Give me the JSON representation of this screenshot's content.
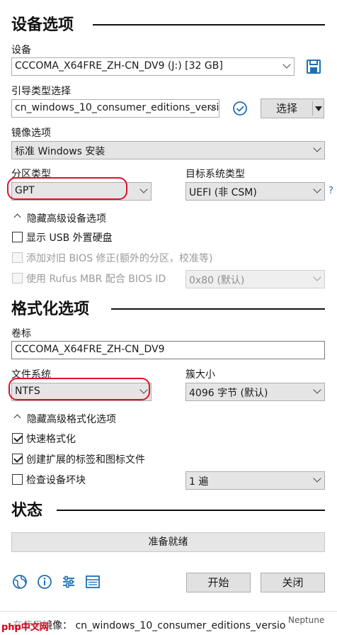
{
  "device_section": {
    "title": "设备选项",
    "device_label": "设备",
    "device_value": "CCCOMA_X64FRE_ZH-CN_DV9 (J:) [32 GB]",
    "boot_label": "引导类型选择",
    "boot_value": "cn_windows_10_consumer_editions_versio",
    "select_button": "选择",
    "image_option_label": "镜像选项",
    "image_option_value": "标准 Windows 安装",
    "partition_label": "分区类型",
    "partition_value": "GPT",
    "target_label": "目标系统类型",
    "target_value": "UEFI (非 CSM)",
    "help_mark": "?",
    "advanced_toggle": "隐藏高级设备选项",
    "usb_hdd_label": "显示 USB 外置硬盘",
    "old_bios_label": "添加对旧 BIOS 修正(额外的分区，校准等)",
    "rufus_mbr_label": "使用 Rufus MBR 配合 BIOS ID",
    "bios_id_value": "0x80 (默认)"
  },
  "format_section": {
    "title": "格式化选项",
    "volume_label": "卷标",
    "volume_value": "CCCOMA_X64FRE_ZH-CN_DV9",
    "fs_label": "文件系统",
    "fs_value": "NTFS",
    "cluster_label": "簇大小",
    "cluster_value": "4096 字节 (默认)",
    "advanced_toggle": "隐藏高级格式化选项",
    "quick_format_label": "快速格式化",
    "extended_label": "创建扩展的标签和图标文件",
    "bad_blocks_label": "检查设备坏块",
    "passes_value": "1 遍"
  },
  "status_section": {
    "title": "状态",
    "status_text": "准备就绪"
  },
  "buttons": {
    "start": "开始",
    "close": "关闭"
  },
  "footer": {
    "text": "在使用镜像： cn_windows_10_consumer_editions_versio",
    "watermark_left": "php中文网",
    "watermark_right": "Neptune"
  },
  "colors": {
    "annotation_red": "#e0112b",
    "icon_blue": "#1f6fb5"
  }
}
